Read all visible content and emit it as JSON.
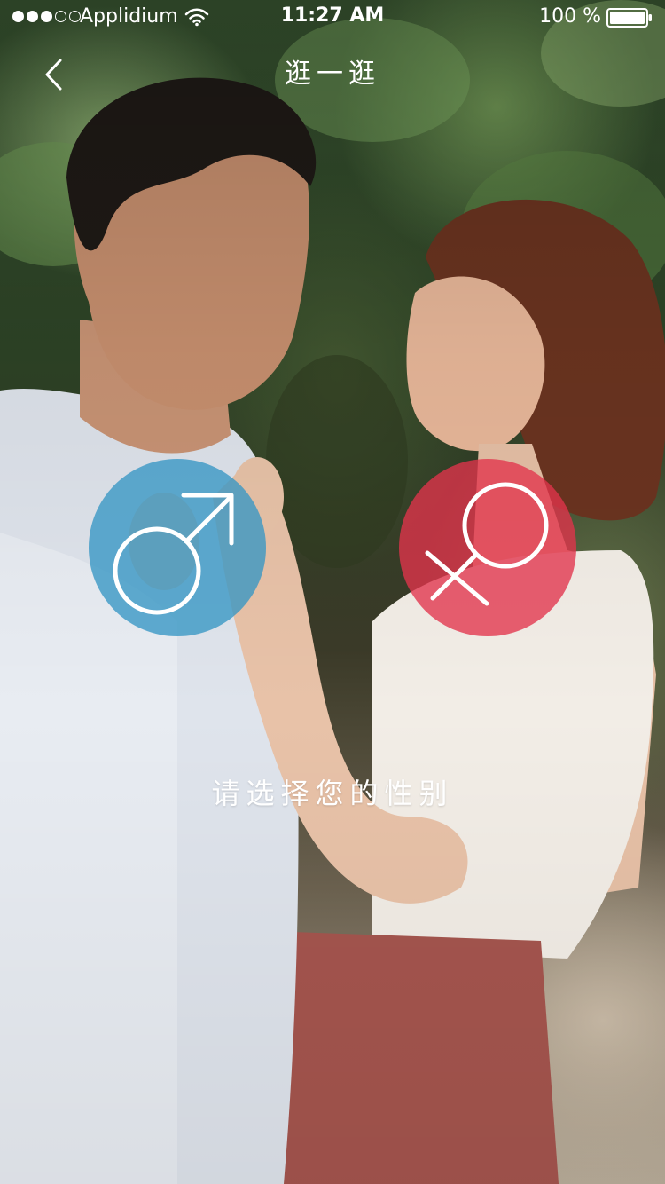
{
  "status_bar": {
    "carrier": "Applidium",
    "time": "11:27 AM",
    "battery": "100 %",
    "signal_bars_filled": 3,
    "signal_bars_total": 5
  },
  "nav": {
    "title": "逛一逛",
    "back_icon": "chevron-left-icon"
  },
  "gender_options": [
    {
      "id": "male",
      "icon": "male-symbol-icon",
      "color": "#3696C4"
    },
    {
      "id": "female",
      "icon": "female-symbol-icon",
      "color": "#E2334C"
    }
  ],
  "prompt": "请选择您的性别"
}
